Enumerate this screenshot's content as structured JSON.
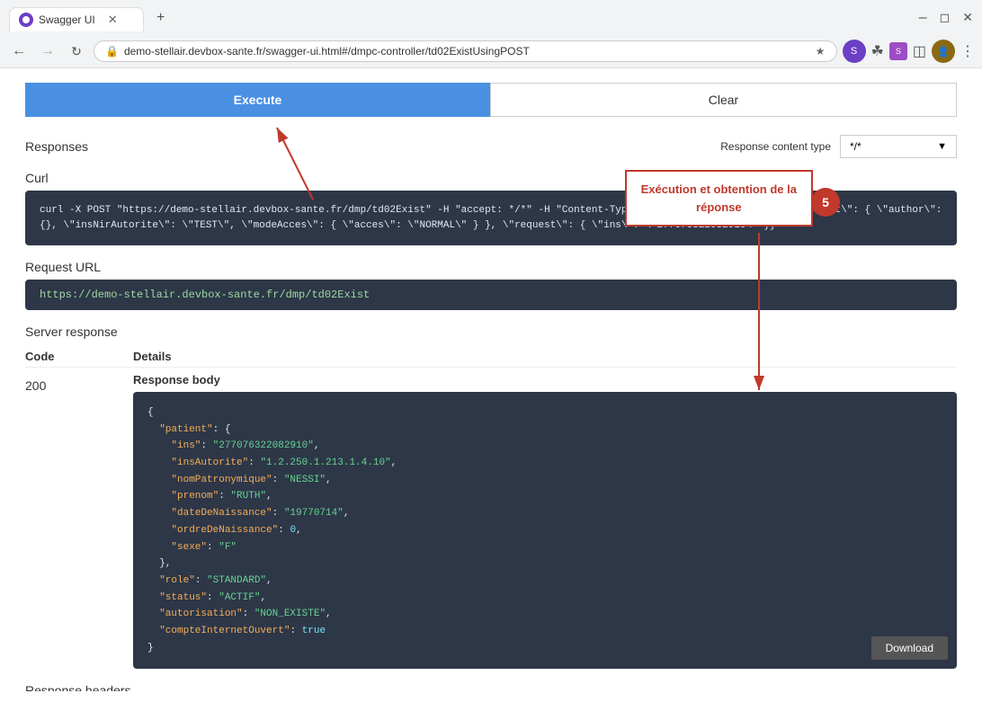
{
  "browser": {
    "tab_title": "Swagger UI",
    "url": "demo-stellair.devbox-sante.fr/swagger-ui.html#/dmpc-controller/td02ExistUsingPOST",
    "new_tab_label": "+"
  },
  "toolbar": {
    "execute_label": "Execute",
    "clear_label": "Clear"
  },
  "responses": {
    "title": "Responses",
    "content_type_label": "Response content type",
    "content_type_value": "*/*"
  },
  "curl": {
    "label": "Curl",
    "value": "curl -X POST \"https://demo-stellair.devbox-sante.fr/dmp/td02Exist\" -H \"accept: */*\" -H \"Content-Type: application/json\" -d \"{ \\\"context\\\": { \\\"author\\\": {}, \\\"insNirAutorite\\\": \\\"TEST\\\", \\\"modeAcces\\\": { \\\"acces\\\": \\\"NORMAL\\\" } }, \\\"request\\\": { \\\"ins\\\": \\\"277076322082910\\\" }}\""
  },
  "request_url": {
    "label": "Request URL",
    "value": "https://demo-stellair.devbox-sante.fr/dmp/td02Exist"
  },
  "server_response": {
    "title": "Server response",
    "code_header": "Code",
    "details_header": "Details",
    "code": "200",
    "response_body_label": "Response body"
  },
  "annotation": {
    "step": "5",
    "text_line1": "Exécution et obtention de la",
    "text_line2": "réponse"
  },
  "response_body": {
    "content": "{\n  \"patient\": {\n    \"ins\": \"277076322082910\",\n    \"insAutorite\": \"1.2.250.1.213.1.4.10\",\n    \"nomPatronymique\": \"NESSI\",\n    \"prenom\": \"RUTH\",\n    \"dateDeNaissance\": \"19770714\",\n    \"ordreDeNaissance\": 0,\n    \"sexe\": \"F\"\n  },\n  \"role\": \"STANDARD\",\n  \"status\": \"ACTIF\",\n  \"autorisation\": \"NON_EXISTE\",\n  \"compteInternetOuvert\": true\n}"
  },
  "download_button": {
    "label": "Download"
  },
  "response_headers": {
    "title": "Response headers"
  }
}
